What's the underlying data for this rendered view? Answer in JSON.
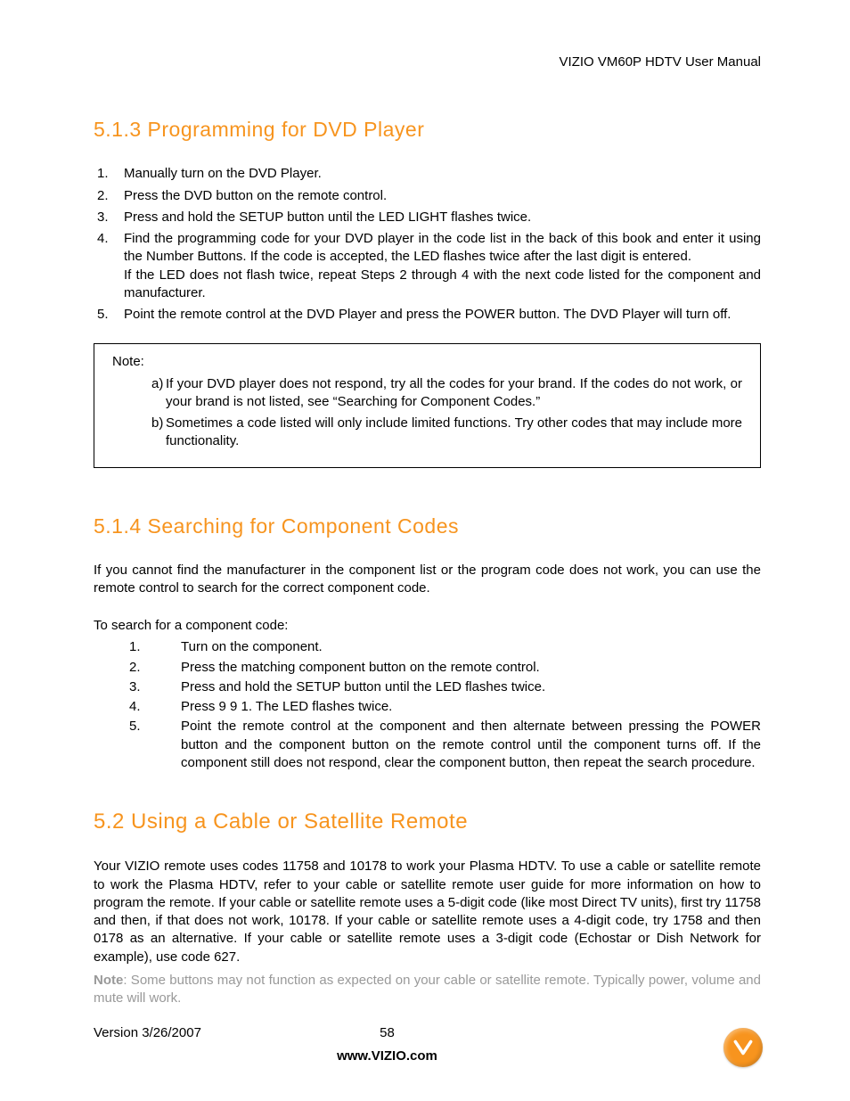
{
  "header": {
    "right": "VIZIO VM60P HDTV User Manual"
  },
  "sections": {
    "dvd": {
      "title": "5.1.3 Programming for DVD Player",
      "items": [
        "Manually turn on the DVD Player.",
        "Press the DVD button on the remote control.",
        "Press and hold the SETUP button until the LED LIGHT flashes twice.",
        "Find the programming code for your DVD player in the code list in the back of this book and enter it using the Number Buttons.  If the code is accepted, the LED flashes twice after the last digit is entered.\nIf the LED does not flash twice, repeat Steps 2 through 4 with the next code listed for the component and manufacturer.",
        "Point the remote control at the DVD Player and press the POWER button.  The DVD Player will turn off."
      ],
      "note_label": "Note:",
      "notes": [
        {
          "letter": "a)",
          "text": "If your DVD player does not respond, try all the codes for your brand.  If the codes do not work, or your brand is not listed, see “Searching for Component Codes.”"
        },
        {
          "letter": "b)",
          "text": "Sometimes a code listed will only include limited functions.  Try other codes that may include more functionality."
        }
      ]
    },
    "search": {
      "title": "5.1.4 Searching for Component Codes",
      "intro": "If you cannot find the manufacturer in the component list or the program code does not work, you can use the remote control to search for the correct component code.",
      "prompt": "To search for a component code:",
      "steps": [
        "Turn on the component.",
        "Press the matching component button on the remote control.",
        "Press and hold the SETUP button until the LED flashes twice.",
        "Press 9 9 1.  The LED flashes twice.",
        "Point the remote control at the component and then alternate between pressing the POWER button and the component button on the remote control until the component turns off.  If the component still does not respond, clear the component button, then repeat the search procedure."
      ]
    },
    "cable": {
      "title": "5.2 Using a Cable or Satellite Remote",
      "body": "Your VIZIO remote uses codes 11758 and 10178 to work your Plasma HDTV.  To use a cable or satellite remote to work the Plasma HDTV, refer to your cable or satellite remote user guide for more information on how to program the remote.  If your cable or satellite remote uses a 5-digit code (like most Direct TV units), first try 11758 and then, if that does not work, 10178.  If your cable or satellite remote uses a 4-digit code, try 1758 and then 0178 as an alternative.  If your cable or satellite remote uses a 3-digit code (Echostar or Dish Network for example), use code 627.",
      "note_label": "Note",
      "note_text": ": Some buttons may not function as expected on your cable or satellite remote.  Typically power, volume and mute will work."
    }
  },
  "footer": {
    "version": "Version 3/26/2007",
    "page": "58",
    "url": "www.VIZIO.com"
  }
}
